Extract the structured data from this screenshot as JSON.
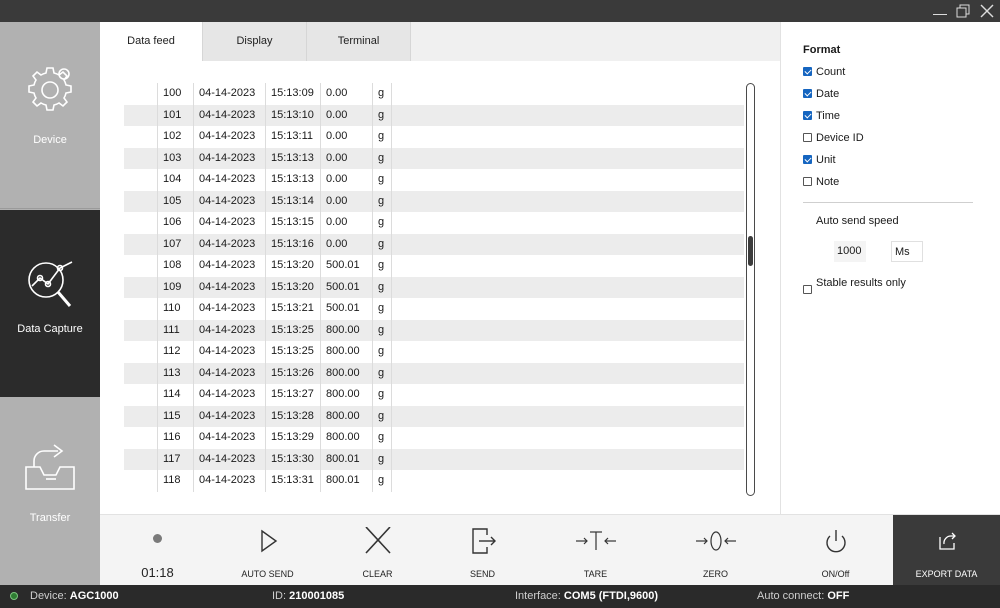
{
  "window": {
    "controls": [
      "minimize-icon",
      "restore-icon",
      "close-icon"
    ]
  },
  "sidebar": {
    "items": [
      {
        "label": "Device",
        "icon": "gear-icon",
        "active": false
      },
      {
        "label": "Data Capture",
        "icon": "chart-magnifier-icon",
        "active": true
      },
      {
        "label": "Transfer",
        "icon": "export-box-icon",
        "active": false
      }
    ]
  },
  "tabs": [
    {
      "label": "Data feed",
      "active": true
    },
    {
      "label": "Display",
      "active": false
    },
    {
      "label": "Terminal",
      "active": false
    }
  ],
  "table": {
    "rows": [
      {
        "count": "100",
        "date": "04-14-2023",
        "time": "15:13:09",
        "value": "0.00",
        "unit": "g"
      },
      {
        "count": "101",
        "date": "04-14-2023",
        "time": "15:13:10",
        "value": "0.00",
        "unit": "g"
      },
      {
        "count": "102",
        "date": "04-14-2023",
        "time": "15:13:11",
        "value": "0.00",
        "unit": "g"
      },
      {
        "count": "103",
        "date": "04-14-2023",
        "time": "15:13:13",
        "value": "0.00",
        "unit": "g"
      },
      {
        "count": "104",
        "date": "04-14-2023",
        "time": "15:13:13",
        "value": "0.00",
        "unit": "g"
      },
      {
        "count": "105",
        "date": "04-14-2023",
        "time": "15:13:14",
        "value": "0.00",
        "unit": "g"
      },
      {
        "count": "106",
        "date": "04-14-2023",
        "time": "15:13:15",
        "value": "0.00",
        "unit": "g"
      },
      {
        "count": "107",
        "date": "04-14-2023",
        "time": "15:13:16",
        "value": "0.00",
        "unit": "g"
      },
      {
        "count": "108",
        "date": "04-14-2023",
        "time": "15:13:20",
        "value": "500.01",
        "unit": "g"
      },
      {
        "count": "109",
        "date": "04-14-2023",
        "time": "15:13:20",
        "value": "500.01",
        "unit": "g"
      },
      {
        "count": "110",
        "date": "04-14-2023",
        "time": "15:13:21",
        "value": "500.01",
        "unit": "g"
      },
      {
        "count": "111",
        "date": "04-14-2023",
        "time": "15:13:25",
        "value": "800.00",
        "unit": "g"
      },
      {
        "count": "112",
        "date": "04-14-2023",
        "time": "15:13:25",
        "value": "800.00",
        "unit": "g"
      },
      {
        "count": "113",
        "date": "04-14-2023",
        "time": "15:13:26",
        "value": "800.00",
        "unit": "g"
      },
      {
        "count": "114",
        "date": "04-14-2023",
        "time": "15:13:27",
        "value": "800.00",
        "unit": "g"
      },
      {
        "count": "115",
        "date": "04-14-2023",
        "time": "15:13:28",
        "value": "800.00",
        "unit": "g"
      },
      {
        "count": "116",
        "date": "04-14-2023",
        "time": "15:13:29",
        "value": "800.00",
        "unit": "g"
      },
      {
        "count": "117",
        "date": "04-14-2023",
        "time": "15:13:30",
        "value": "800.01",
        "unit": "g"
      },
      {
        "count": "118",
        "date": "04-14-2023",
        "time": "15:13:31",
        "value": "800.01",
        "unit": "g"
      }
    ]
  },
  "format": {
    "title": "Format",
    "options": [
      {
        "label": "Count",
        "checked": true
      },
      {
        "label": "Date",
        "checked": true
      },
      {
        "label": "Time",
        "checked": true
      },
      {
        "label": "Device ID",
        "checked": false
      },
      {
        "label": "Unit",
        "checked": true
      },
      {
        "label": "Note",
        "checked": false
      }
    ],
    "speed_label": "Auto send speed",
    "speed_value": "1000",
    "speed_unit": "Ms",
    "stable_label": "Stable results only",
    "stable_checked": false
  },
  "toolbar": {
    "timer": "01:18",
    "auto_send": "AUTO SEND",
    "clear": "CLEAR",
    "send": "SEND",
    "tare": "TARE",
    "zero": "ZERO",
    "onoff": "ON/Off",
    "export": "EXPORT DATA"
  },
  "status": {
    "device_label": "Device:",
    "device_value": "AGC1000",
    "id_label": "ID:",
    "id_value": "210001085",
    "interface_label": "Interface:",
    "interface_value": "COM5 (FTDI,9600)",
    "autoconnect_label": "Auto connect:",
    "autoconnect_value": "OFF"
  },
  "colors": {
    "accent": "#1565c0",
    "sidebar_active": "#2b2b2b",
    "sidebar_bg": "#b1b1b1",
    "status_ok": "#2e7d32"
  }
}
